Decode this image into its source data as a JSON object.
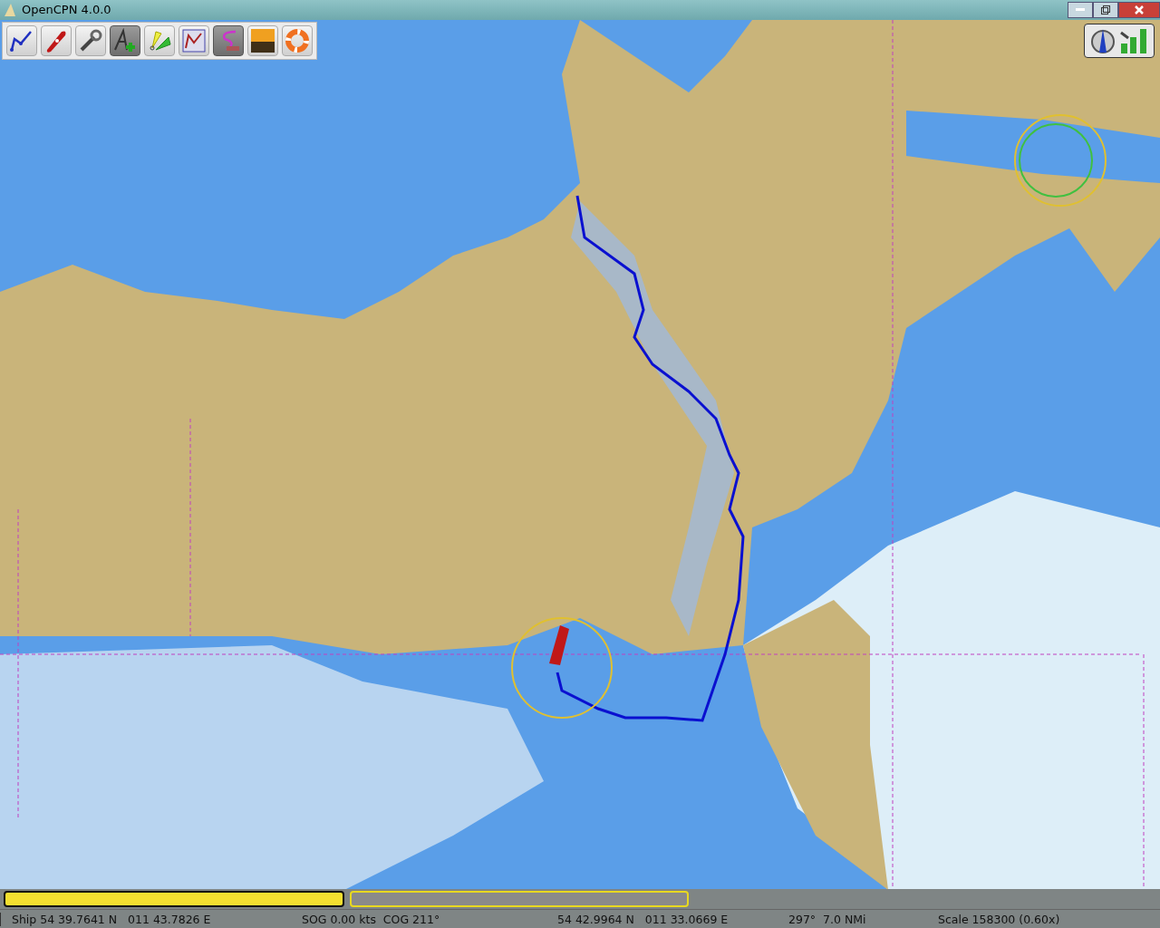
{
  "window": {
    "title": "OpenCPN 4.0.0"
  },
  "toolbar": [
    {
      "kind": "route",
      "selected": false
    },
    {
      "kind": "ship",
      "selected": false
    },
    {
      "kind": "settings",
      "selected": false
    },
    {
      "kind": "text",
      "selected": true
    },
    {
      "kind": "tide",
      "selected": false
    },
    {
      "kind": "list",
      "selected": false
    },
    {
      "kind": "track",
      "selected": true
    },
    {
      "kind": "sunset",
      "selected": false
    },
    {
      "kind": "lifebuoy",
      "selected": false
    }
  ],
  "chart_bar": [
    {
      "selected": true
    },
    {
      "selected": false
    }
  ],
  "status_bar": {
    "ship": "Ship 54 39.7641 N   011 43.7826 E",
    "sog": "SOG 0.00 kts  COG 211°",
    "cursor": "54 42.9964 N   011 33.0669 E",
    "bearing": "297°  7.0 NMi",
    "scale": "Scale 158300 (0.60x)"
  }
}
